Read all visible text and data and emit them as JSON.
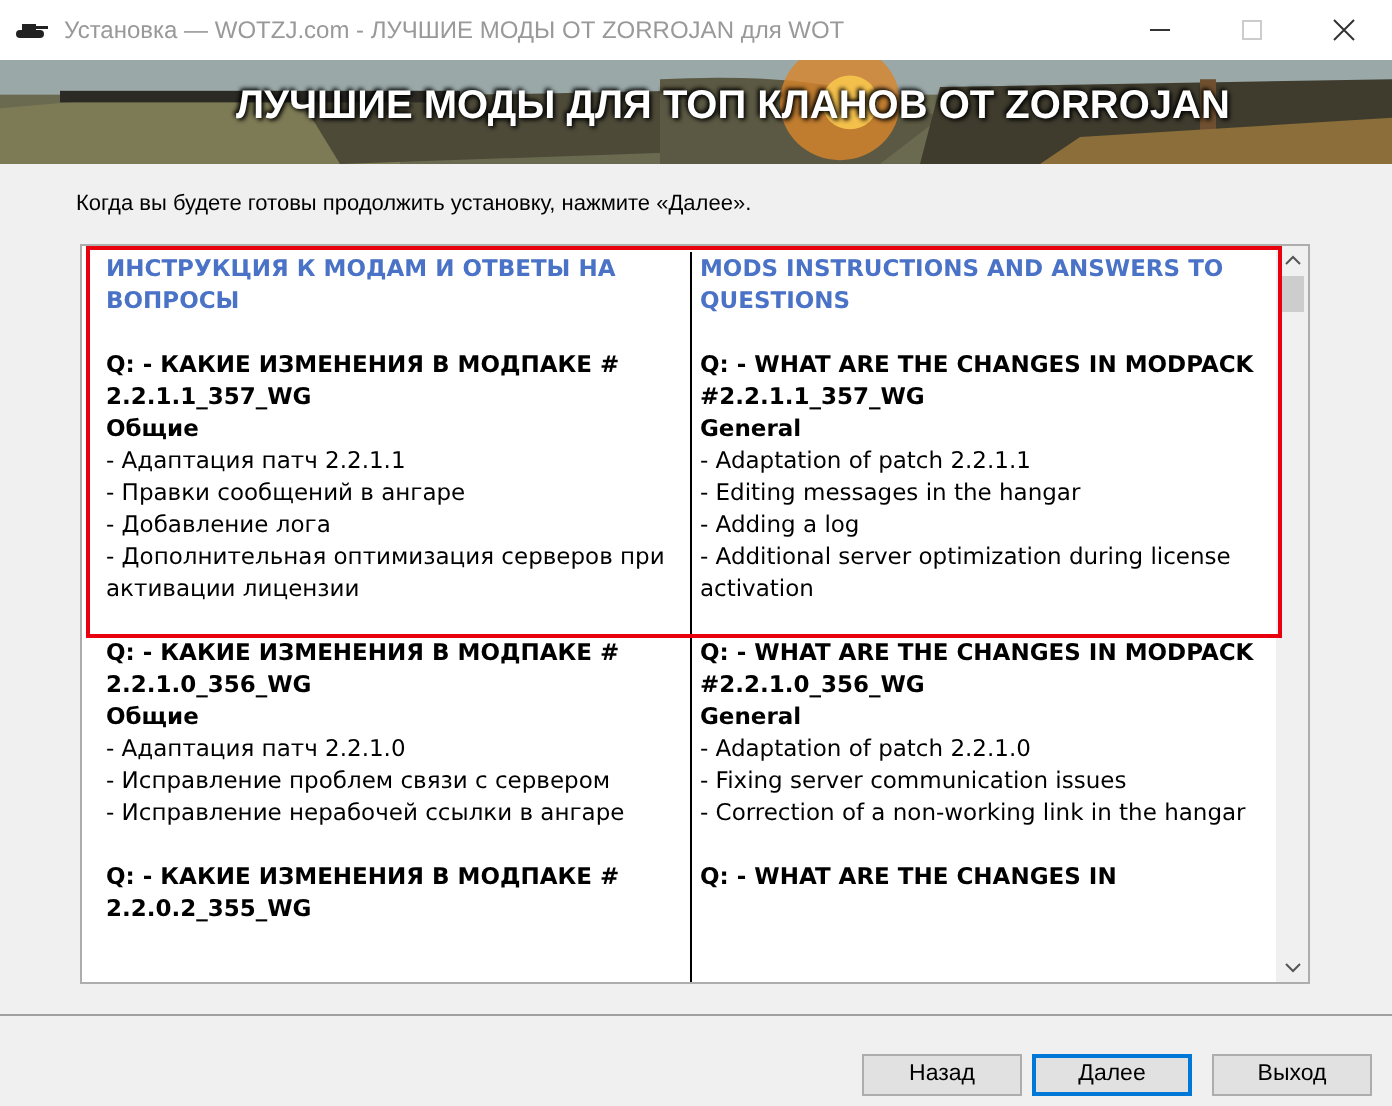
{
  "window": {
    "title": "Установка — WOTZJ.com - ЛУЧШИЕ МОДЫ ОТ ZORROJAN для WOT"
  },
  "banner": {
    "title": "ЛУЧШИЕ МОДЫ ДЛЯ ТОП КЛАНОВ ОТ ZORROJAN"
  },
  "instruction": "Когда вы будете готовы продолжить установку, нажмите «Далее».",
  "columns": [
    {
      "blocks": [
        {
          "kind": "heading",
          "text": "ИНСТРУКЦИЯ К МОДАМ И ОТВЕТЫ НА ВОПРОСЫ"
        },
        {
          "kind": "question",
          "text": "Q: - КАКИЕ ИЗМЕНЕНИЯ В МОДПАКЕ # 2.2.1.1_357_WG"
        },
        {
          "kind": "section",
          "text": "Общие"
        },
        {
          "kind": "item",
          "text": "- Адаптация патч 2.2.1.1"
        },
        {
          "kind": "item",
          "text": "- Правки сообщений в ангаре"
        },
        {
          "kind": "item",
          "text": "- Добавление лога"
        },
        {
          "kind": "item",
          "text": "- Дополнительная оптимизация серверов при активации лицензии"
        },
        {
          "kind": "question",
          "text": "Q: - КАКИЕ ИЗМЕНЕНИЯ В МОДПАКЕ # 2.2.1.0_356_WG"
        },
        {
          "kind": "section",
          "text": "Общие"
        },
        {
          "kind": "item",
          "text": "- Адаптация патч 2.2.1.0"
        },
        {
          "kind": "item",
          "text": "- Исправление проблем связи с сервером"
        },
        {
          "kind": "item",
          "text": "- Исправление нерабочей ссылки в ангаре"
        },
        {
          "kind": "question",
          "text": "Q: - КАКИЕ ИЗМЕНЕНИЯ В МОДПАКЕ # 2.2.0.2_355_WG"
        }
      ]
    },
    {
      "blocks": [
        {
          "kind": "heading",
          "text": "MODS INSTRUCTIONS AND ANSWERS TO QUESTIONS"
        },
        {
          "kind": "question",
          "text": "Q: - WHAT ARE THE CHANGES IN MODPACK"
        },
        {
          "kind": "code",
          "text": "#2.2.1.1_357_WG"
        },
        {
          "kind": "section",
          "text": "General"
        },
        {
          "kind": "item",
          "text": "- Adaptation of patch 2.2.1.1"
        },
        {
          "kind": "item",
          "text": "- Editing messages in the hangar"
        },
        {
          "kind": "item",
          "text": "- Adding a log"
        },
        {
          "kind": "item",
          "text": "- Additional server optimization during license activation"
        },
        {
          "kind": "question",
          "text": "Q: - WHAT ARE THE CHANGES IN MODPACK"
        },
        {
          "kind": "code",
          "text": "#2.2.1.0_356_WG"
        },
        {
          "kind": "section",
          "text": "General"
        },
        {
          "kind": "item",
          "text": "- Adaptation of patch 2.2.1.0"
        },
        {
          "kind": "item",
          "text": "- Fixing server communication issues"
        },
        {
          "kind": "item",
          "text": "- Correction of a non-working link in the hangar"
        },
        {
          "kind": "question",
          "text": "Q: - WHAT ARE THE CHANGES IN"
        }
      ]
    }
  ],
  "buttons": [
    {
      "label": "Назад",
      "selected": false
    },
    {
      "label": "Далее",
      "selected": true
    },
    {
      "label": "Выход",
      "selected": false
    }
  ]
}
